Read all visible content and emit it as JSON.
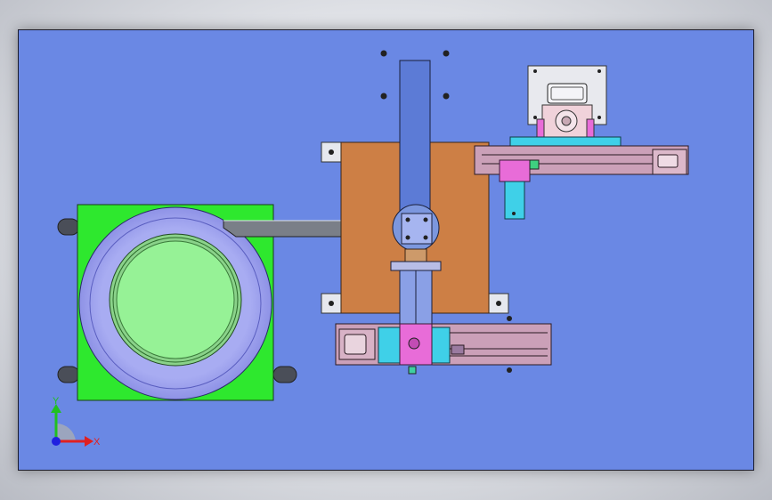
{
  "cad_view": {
    "background_color": "#6a88e4",
    "triad": {
      "x_label": "X",
      "y_label": "Y",
      "x_color": "#e02020",
      "y_color": "#20c020",
      "z_color": "#2020e0"
    },
    "components": {
      "feeder_bowl_base_color": "#2ee82e",
      "bowl_ring_color": "#a4a8f0",
      "bowl_inner_color": "#96f296",
      "mount_plate_color": "#cd7f45",
      "robot_arm_color": "#5c7bd6",
      "linear_slide_color": "#cba0b8",
      "carriage_color": "#e86cd8",
      "bracket_color": "#3fd0e8"
    }
  }
}
